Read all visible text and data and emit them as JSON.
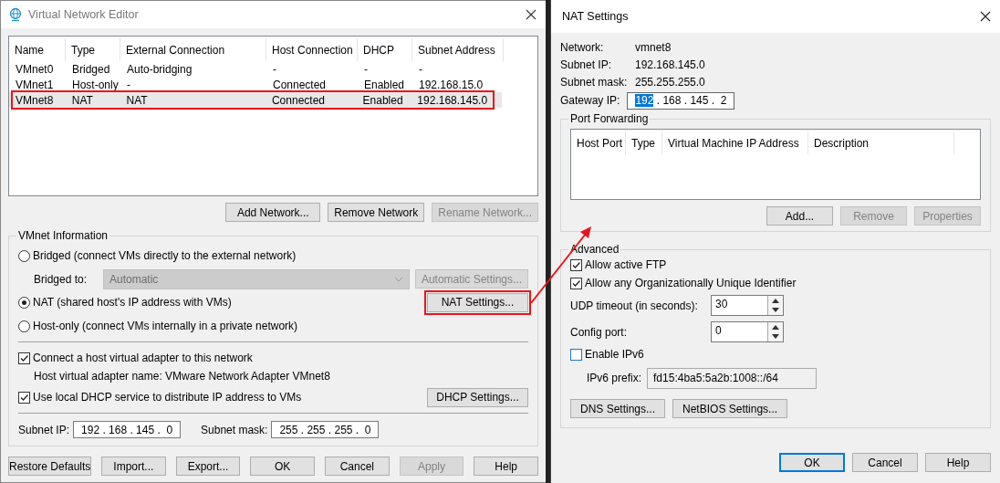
{
  "editor": {
    "title": "Virtual Network Editor",
    "columns": [
      "Name",
      "Type",
      "External Connection",
      "Host Connection",
      "DHCP",
      "Subnet Address"
    ],
    "rows": [
      {
        "cells": [
          "VMnet0",
          "Bridged",
          "Auto-bridging",
          "-",
          "-",
          "-"
        ],
        "selected": false,
        "annotated": false
      },
      {
        "cells": [
          "VMnet1",
          "Host-only",
          "-",
          "Connected",
          "Enabled",
          "192.168.15.0"
        ],
        "selected": false,
        "annotated": false
      },
      {
        "cells": [
          "VMnet8",
          "NAT",
          "NAT",
          "Connected",
          "Enabled",
          "192.168.145.0"
        ],
        "selected": true,
        "annotated": true
      }
    ],
    "list_buttons": [
      {
        "label": "Add Network...",
        "disabled": false
      },
      {
        "label": "Remove Network",
        "disabled": false
      },
      {
        "label": "Rename Network...",
        "disabled": true
      }
    ],
    "info": {
      "title": "VMnet Information",
      "options": [
        {
          "label": "Bridged (connect VMs directly to the external network)",
          "selected": false
        },
        {
          "label": "NAT (shared host's IP address with VMs)",
          "selected": true
        },
        {
          "label": "Host-only (connect VMs internally in a private network)",
          "selected": false
        }
      ],
      "bridged_to": {
        "label": "Bridged to:",
        "value": "Automatic",
        "disabled": true
      },
      "automatic_settings": {
        "label": "Automatic Settings...",
        "disabled": true
      },
      "nat_settings": {
        "label": "NAT Settings...",
        "annotated": true
      },
      "connect_adapter": {
        "label": "Connect a host virtual adapter to this network",
        "checked": true
      },
      "adapter_name": "Host virtual adapter name: VMware Network Adapter VMnet8",
      "use_dhcp": {
        "label": "Use local DHCP service to distribute IP address to VMs",
        "checked": true
      },
      "dhcp_settings": "DHCP Settings...",
      "subnet_ip": {
        "label": "Subnet IP:",
        "value": "192 . 168 . 145 .  0"
      },
      "subnet_mask": {
        "label": "Subnet mask:",
        "value": "255 . 255 . 255 .  0"
      }
    },
    "footer_buttons": [
      {
        "label": "Restore Defaults",
        "disabled": false
      },
      {
        "label": "Import...",
        "disabled": false
      },
      {
        "label": "Export...",
        "disabled": false
      },
      {
        "label": "OK",
        "disabled": false
      },
      {
        "label": "Cancel",
        "disabled": false
      },
      {
        "label": "Apply",
        "disabled": true
      },
      {
        "label": "Help",
        "disabled": false
      }
    ]
  },
  "nat": {
    "title": "NAT Settings",
    "info": [
      {
        "label": "Network:",
        "value": "vmnet8"
      },
      {
        "label": "Subnet IP:",
        "value": "192.168.145.0"
      },
      {
        "label": "Subnet mask:",
        "value": "255.255.255.0"
      }
    ],
    "gateway": {
      "label": "Gateway IP:",
      "parts": [
        {
          "text": "192",
          "selected": true
        },
        {
          "text": ". 168 . 145 .  2",
          "selected": false
        }
      ]
    },
    "port_forwarding": {
      "title": "Port Forwarding",
      "columns": [
        "Host Port",
        "Type",
        "Virtual Machine IP Address",
        "Description"
      ],
      "buttons": [
        {
          "label": "Add...",
          "disabled": false
        },
        {
          "label": "Remove",
          "disabled": true
        },
        {
          "label": "Properties",
          "disabled": true
        }
      ]
    },
    "advanced": {
      "title": "Advanced",
      "checks": [
        {
          "label": "Allow active FTP",
          "checked": true
        },
        {
          "label": "Allow any Organizationally Unique Identifier",
          "checked": true
        }
      ],
      "spinners": [
        {
          "label": "UDP timeout (in seconds):",
          "value": "30"
        },
        {
          "label": "Config port:",
          "value": "0"
        }
      ],
      "ipv6": {
        "label": "Enable IPv6",
        "checked": false
      },
      "ipv6_prefix": {
        "label": "IPv6 prefix:",
        "value": "fd15:4ba5:5a2b:1008::/64",
        "disabled": true
      },
      "buttons": [
        {
          "label": "DNS Settings..."
        },
        {
          "label": "NetBIOS Settings..."
        }
      ]
    },
    "buttons": [
      {
        "label": "OK",
        "default": true
      },
      {
        "label": "Cancel",
        "default": false
      },
      {
        "label": "Help",
        "default": false
      }
    ]
  }
}
